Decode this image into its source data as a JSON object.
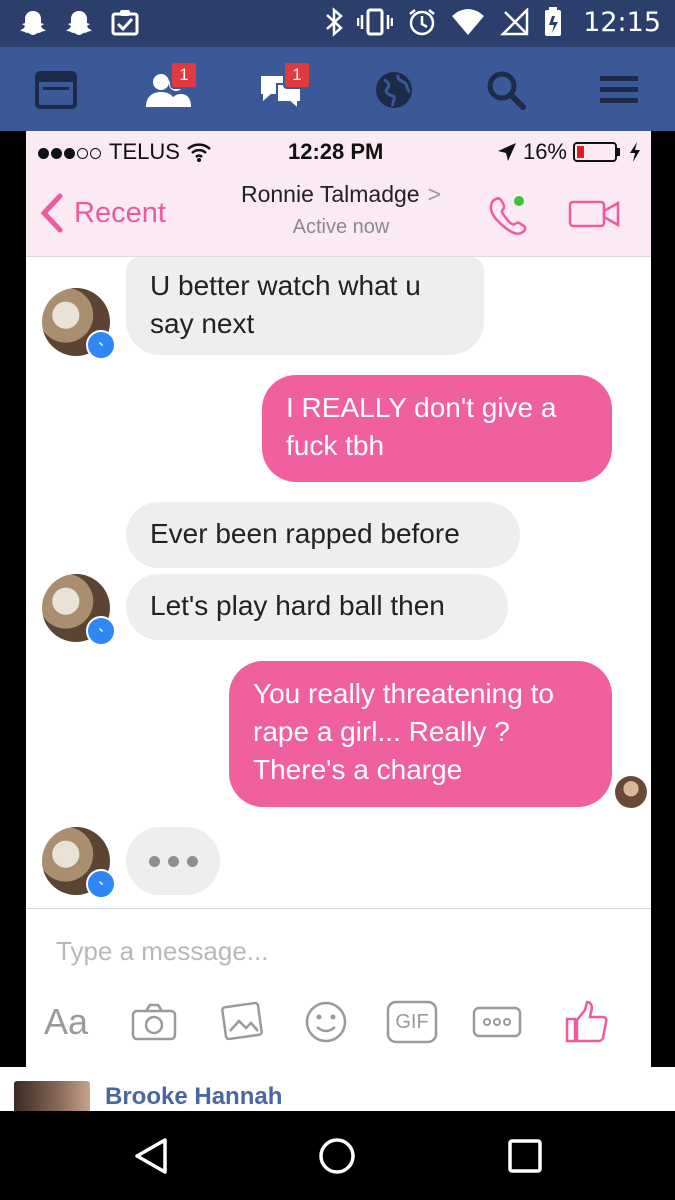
{
  "android_status": {
    "time": "12:15",
    "left_icons": [
      "snapchat-icon",
      "snapchat-icon",
      "clipboard-check-icon"
    ],
    "right_icons": [
      "bluetooth-icon",
      "vibrate-icon",
      "alarm-icon",
      "wifi-icon",
      "no-signal-icon",
      "battery-icon"
    ]
  },
  "fb_nav": {
    "bg_color": "#3b5998",
    "items": [
      {
        "icon": "news-feed-icon",
        "badge": ""
      },
      {
        "icon": "friend-requests-icon",
        "badge": "1"
      },
      {
        "icon": "messages-icon",
        "badge": "1"
      },
      {
        "icon": "globe-notifications-icon",
        "badge": ""
      },
      {
        "icon": "search-icon",
        "badge": ""
      },
      {
        "icon": "menu-icon",
        "badge": ""
      }
    ]
  },
  "ios_status": {
    "carrier": "TELUS",
    "time": "12:28 PM",
    "battery": "16%"
  },
  "conversation": {
    "back_label": "Recent",
    "contact_name": "Ronnie Talmadge",
    "contact_status": "Active now",
    "accent_color": "#f0609e",
    "messages": [
      {
        "from": "them",
        "text": "U better watch what u say next"
      },
      {
        "from": "me",
        "text": "I REALLY don't give a fuck tbh"
      },
      {
        "from": "them",
        "text": "Ever been rapped before"
      },
      {
        "from": "them",
        "text": "Let's play hard ball then"
      },
      {
        "from": "me",
        "text": "You really threatening to rape a girl... Really ? There's a charge"
      }
    ],
    "composer_placeholder": "Type a message...",
    "toolbar": {
      "text_style_label": "Aa",
      "gif_label": "GIF"
    }
  },
  "post": {
    "author": "Brooke Hannah"
  }
}
